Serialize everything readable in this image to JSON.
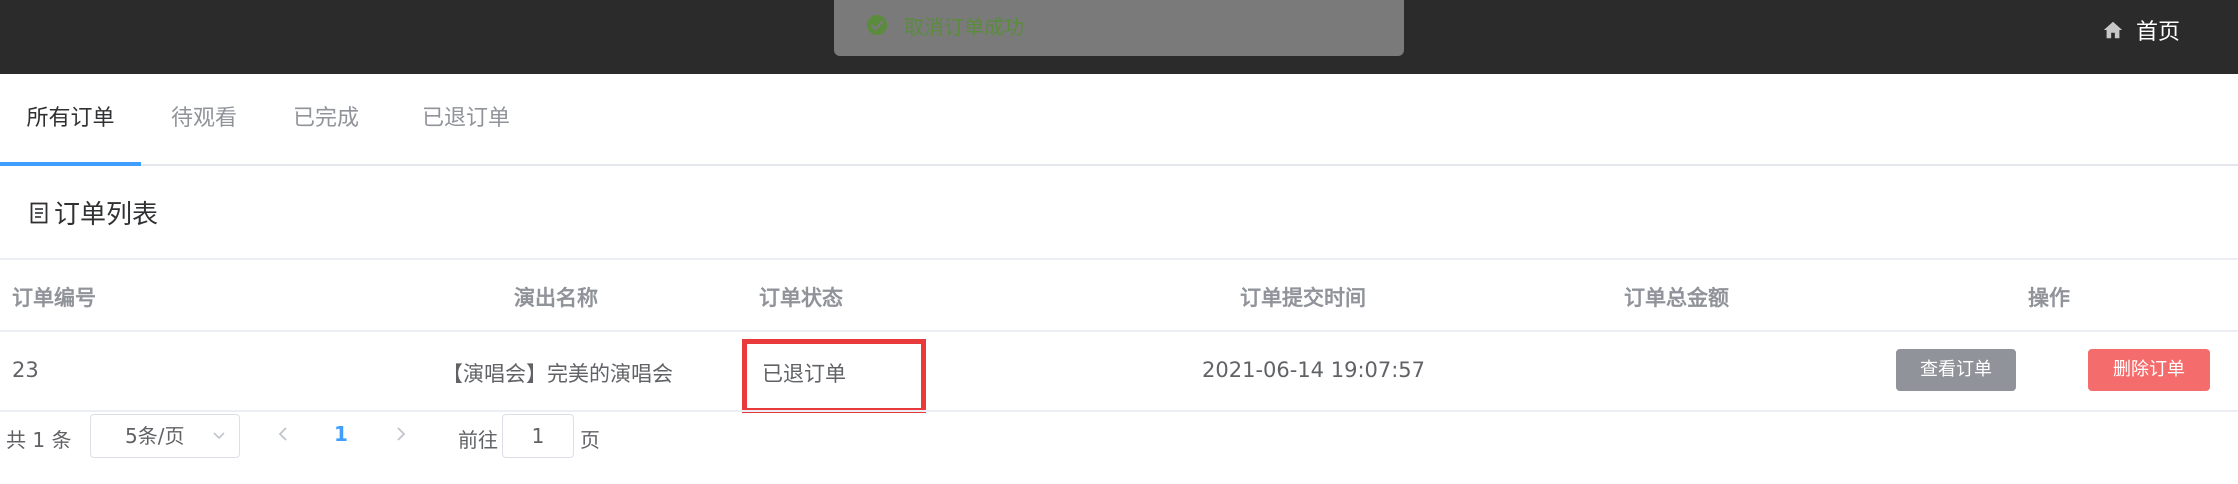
{
  "header": {
    "home_label": "首页"
  },
  "toast": {
    "message": "取消订单成功"
  },
  "tabs": [
    {
      "label": "所有订单"
    },
    {
      "label": "待观看"
    },
    {
      "label": "已完成"
    },
    {
      "label": "已退订单"
    }
  ],
  "section": {
    "title": "订单列表"
  },
  "table": {
    "columns": [
      "订单编号",
      "演出名称",
      "订单状态",
      "订单提交时间",
      "订单总金额",
      "操作"
    ],
    "rows": [
      {
        "order_id": "23",
        "show_name": "【演唱会】完美的演唱会",
        "status": "已退订单",
        "submit_time": "2021-06-14 19:07:57",
        "total": "",
        "view_label": "查看订单",
        "delete_label": "删除订单"
      }
    ]
  },
  "pagination": {
    "total_text": "共 1 条",
    "page_size": "5条/页",
    "current_page": "1",
    "goto_prefix": "前往",
    "goto_value": "1",
    "goto_suffix": "页"
  },
  "colors": {
    "accent": "#409eff",
    "danger": "#f56c6c",
    "topbar": "#2b2b2b",
    "highlight_box": "#e83a3a"
  }
}
